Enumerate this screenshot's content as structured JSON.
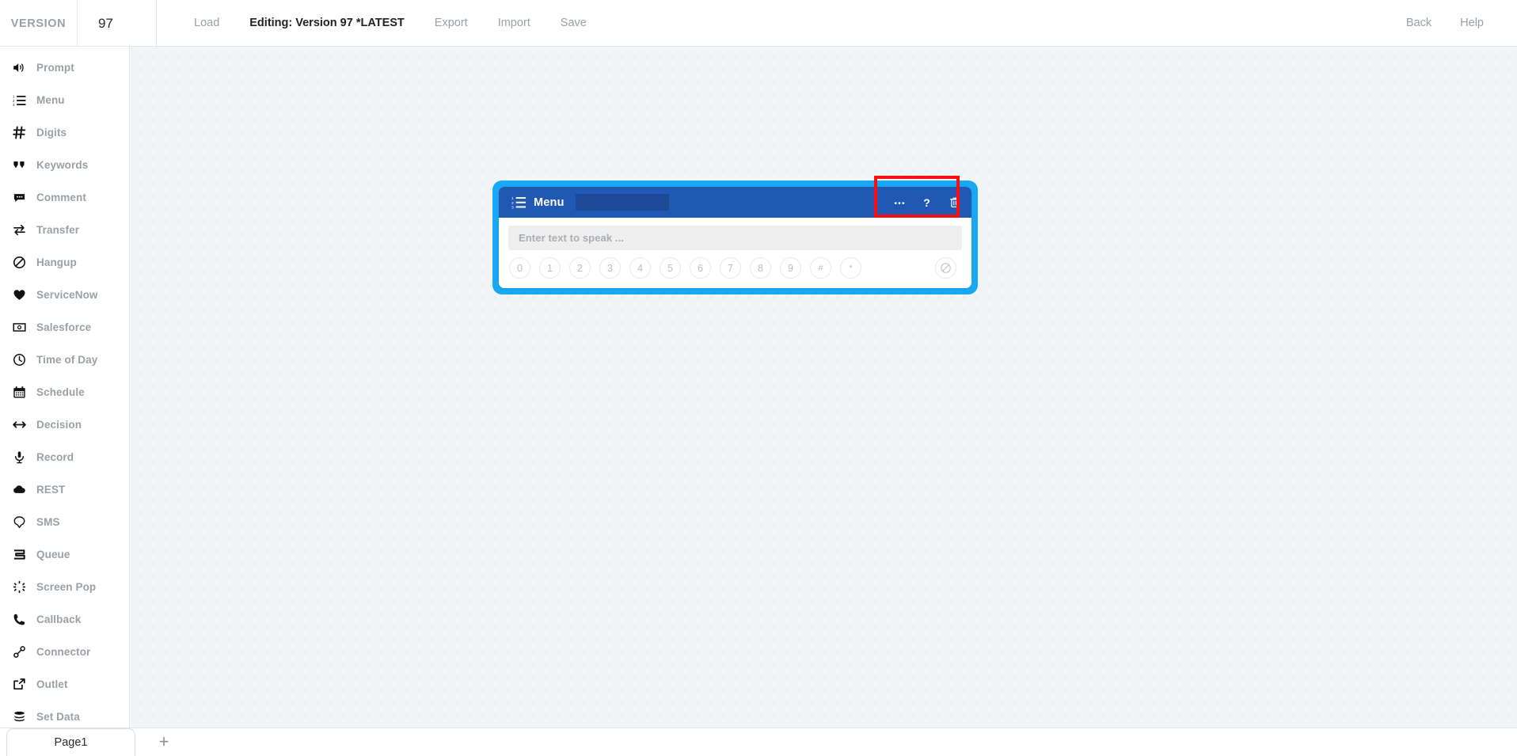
{
  "topbar": {
    "version_label": "VERSION",
    "version_value": "97",
    "actions": [
      {
        "label": "Load",
        "active": false,
        "name": "load-button"
      },
      {
        "label": "Editing: Version 97 *LATEST",
        "active": true,
        "name": "editing-status"
      },
      {
        "label": "Export",
        "active": false,
        "name": "export-button"
      },
      {
        "label": "Import",
        "active": false,
        "name": "import-button"
      },
      {
        "label": "Save",
        "active": false,
        "name": "save-button"
      }
    ],
    "right_actions": [
      {
        "label": "Back",
        "name": "back-button"
      },
      {
        "label": "Help",
        "name": "help-button"
      }
    ]
  },
  "sidebar": {
    "items": [
      {
        "label": "Prompt",
        "icon": "speaker-icon"
      },
      {
        "label": "Menu",
        "icon": "numbered-list-icon"
      },
      {
        "label": "Digits",
        "icon": "hash-icon"
      },
      {
        "label": "Keywords",
        "icon": "quotes-icon"
      },
      {
        "label": "Comment",
        "icon": "comment-icon"
      },
      {
        "label": "Transfer",
        "icon": "transfer-arrows-icon"
      },
      {
        "label": "Hangup",
        "icon": "no-entry-icon"
      },
      {
        "label": "ServiceNow",
        "icon": "heart-icon"
      },
      {
        "label": "Salesforce",
        "icon": "card-icon"
      },
      {
        "label": "Time of Day",
        "icon": "clock-icon"
      },
      {
        "label": "Schedule",
        "icon": "calendar-icon"
      },
      {
        "label": "Decision",
        "icon": "double-arrow-icon"
      },
      {
        "label": "Record",
        "icon": "microphone-icon"
      },
      {
        "label": "REST",
        "icon": "cloud-icon"
      },
      {
        "label": "SMS",
        "icon": "speech-bubble-icon"
      },
      {
        "label": "Queue",
        "icon": "queue-icon"
      },
      {
        "label": "Screen Pop",
        "icon": "burst-icon"
      },
      {
        "label": "Callback",
        "icon": "phone-icon"
      },
      {
        "label": "Connector",
        "icon": "link-icon"
      },
      {
        "label": "Outlet",
        "icon": "external-link-icon"
      },
      {
        "label": "Set Data",
        "icon": "database-icon"
      }
    ]
  },
  "node": {
    "title": "Menu",
    "header_icon": "numbered-list-icon",
    "name_value": "",
    "text_placeholder": "Enter text to speak ...",
    "text_value": "",
    "actions": [
      {
        "name": "more-options-button",
        "icon": "ellipsis-icon",
        "glyph": "•••"
      },
      {
        "name": "help-button",
        "icon": "question-mark-icon",
        "glyph": "?"
      },
      {
        "name": "delete-button",
        "icon": "trash-icon",
        "glyph": ""
      }
    ],
    "keys": [
      "0",
      "1",
      "2",
      "3",
      "4",
      "5",
      "6",
      "7",
      "8",
      "9",
      "#",
      "*"
    ],
    "hangup_key": {
      "name": "hangup-key",
      "icon": "no-entry-icon"
    }
  },
  "bottombar": {
    "page_tab_label": "Page1",
    "add_page_label": "+"
  },
  "colors": {
    "node_header": "#2158b4",
    "selection_ring": "#19a8f5",
    "highlight": "#ff0d0d",
    "canvas": "#f1f4f6",
    "muted_text": "#9aa0a6"
  }
}
